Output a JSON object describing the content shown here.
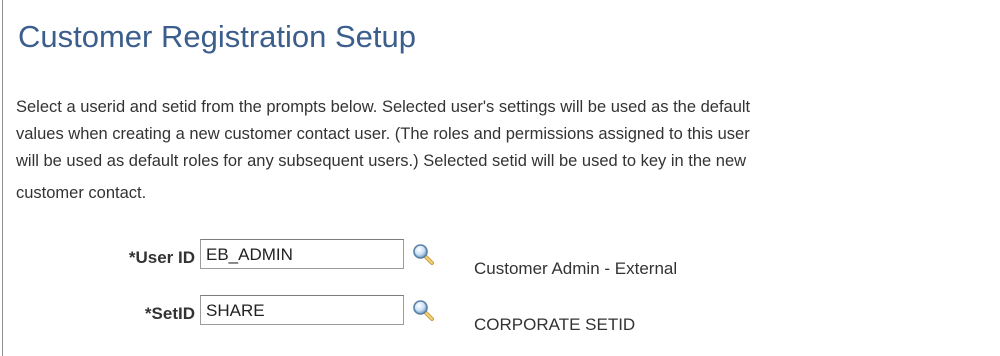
{
  "page": {
    "title": "Customer Registration Setup",
    "instructions": [
      "Select a userid and setid from the prompts below. Selected user's settings will be used as the default",
      "values when creating a new customer contact user. (The roles and permissions assigned to this user",
      "will be used as default roles for any subsequent users.) Selected setid will be used to key in the new",
      "customer contact."
    ]
  },
  "form": {
    "user_id": {
      "label": "*User ID",
      "value": "EB_ADMIN",
      "description": "Customer Admin - External",
      "lookup_icon": "magnifier-icon"
    },
    "set_id": {
      "label": "*SetID",
      "value": "SHARE",
      "description": "CORPORATE SETID",
      "lookup_icon": "magnifier-icon"
    }
  },
  "colors": {
    "title": "#3b5e8c",
    "text": "#333333",
    "border": "#8f8f8f"
  }
}
